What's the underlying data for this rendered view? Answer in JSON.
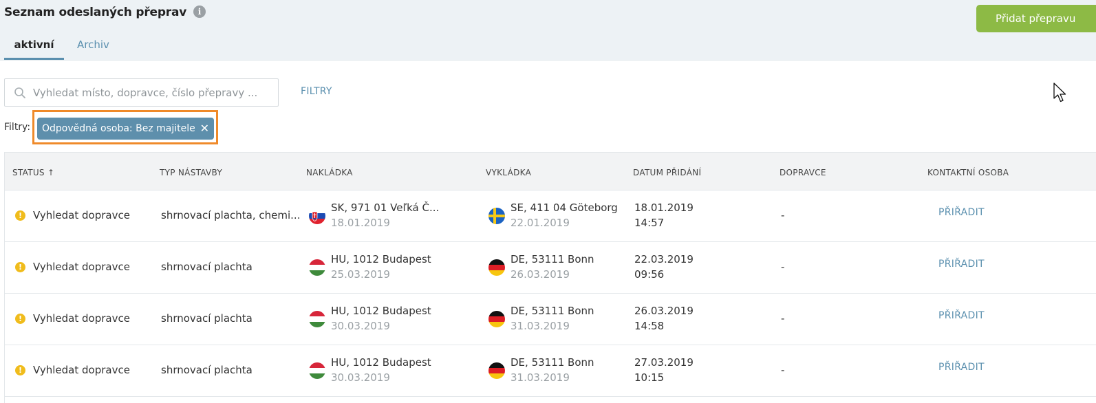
{
  "header": {
    "title": "Seznam odeslaných přeprav",
    "info_icon": "i",
    "add_button": "Přidat přepravu",
    "tabs": [
      {
        "label": "aktivní",
        "active": true
      },
      {
        "label": "Archiv",
        "active": false
      }
    ]
  },
  "search": {
    "placeholder": "Vyhledat místo, dopravce, číslo přepravy ...",
    "value": ""
  },
  "filters": {
    "link_label": "FILTRY",
    "label": "Filtry:",
    "chip_label": "Odpovědná osoba: Bez majitele",
    "chip_close": "✕"
  },
  "table": {
    "columns": [
      "STATUS ↑",
      "TYP NÁSTAVBY",
      "NAKLÁDKA",
      "VYKLÁDKA",
      "DATUM PŘIDÁNÍ",
      "DOPRAVCE",
      "KONTAKTNÍ OSOBA"
    ],
    "rows": [
      {
        "warn": "!",
        "status": "Vyhledat dopravce",
        "body_type": "shrnovací plachta, chemi...",
        "loading_place": "SK, 971 01 Veľká Č...",
        "loading_date": "18.01.2019",
        "loading_flag": "sk",
        "unloading_place": "SE, 411 04 Göteborg",
        "unloading_date": "22.01.2019",
        "unloading_flag": "se",
        "added_date": "18.01.2019",
        "added_time": "14:57",
        "carrier": "-",
        "contact": "PŘIŘADIT"
      },
      {
        "warn": "!",
        "status": "Vyhledat dopravce",
        "body_type": "shrnovací plachta",
        "loading_place": "HU, 1012 Budapest",
        "loading_date": "25.03.2019",
        "loading_flag": "hu",
        "unloading_place": "DE, 53111 Bonn",
        "unloading_date": "26.03.2019",
        "unloading_flag": "de",
        "added_date": "22.03.2019",
        "added_time": "09:56",
        "carrier": "-",
        "contact": "PŘIŘADIT"
      },
      {
        "warn": "!",
        "status": "Vyhledat dopravce",
        "body_type": "shrnovací plachta",
        "loading_place": "HU, 1012 Budapest",
        "loading_date": "30.03.2019",
        "loading_flag": "hu",
        "unloading_place": "DE, 53111 Bonn",
        "unloading_date": "31.03.2019",
        "unloading_flag": "de",
        "added_date": "26.03.2019",
        "added_time": "14:58",
        "carrier": "-",
        "contact": "PŘIŘADIT"
      },
      {
        "warn": "!",
        "status": "Vyhledat dopravce",
        "body_type": "shrnovací plachta",
        "loading_place": "HU, 1012 Budapest",
        "loading_date": "30.03.2019",
        "loading_flag": "hu",
        "unloading_place": "DE, 53111 Bonn",
        "unloading_date": "31.03.2019",
        "unloading_flag": "de",
        "added_date": "27.03.2019",
        "added_time": "10:15",
        "carrier": "-",
        "contact": "PŘIŘADIT"
      }
    ]
  },
  "colors": {
    "accent": "#5a8fae",
    "add_button": "#8dba45",
    "highlight_frame": "#ef8a2a",
    "warning": "#f0bc1c"
  }
}
